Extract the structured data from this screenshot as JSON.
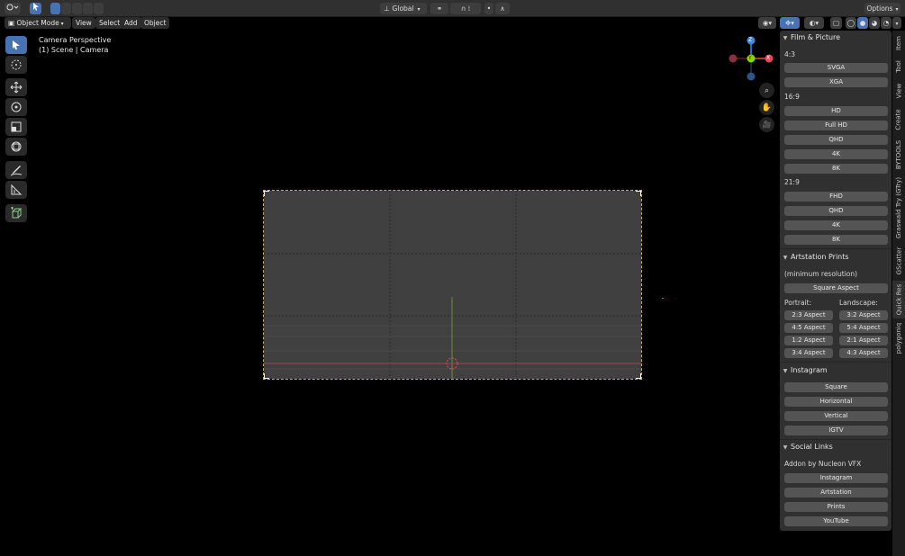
{
  "header": {
    "transform_orientation": "Global",
    "options_label": "Options"
  },
  "menubar": {
    "mode": "Object Mode",
    "items": [
      "View",
      "Select",
      "Add",
      "Object"
    ]
  },
  "viewport": {
    "perspective_label": "Camera Perspective",
    "scene_label": "(1) Scene | Camera",
    "gizmo": {
      "z": "Z",
      "y": "Y",
      "x": "X"
    }
  },
  "panel": {
    "film": {
      "title": "Film & Picture",
      "ratio_4_3": "4:3",
      "buttons_4_3": [
        "SVGA",
        "XGA"
      ],
      "ratio_16_9": "16:9",
      "buttons_16_9": [
        "HD",
        "Full HD",
        "QHD",
        "4K",
        "8K"
      ],
      "ratio_21_9": "21:9",
      "buttons_21_9": [
        "FHD",
        "QHD",
        "4K",
        "8K"
      ]
    },
    "artstation": {
      "title": "Artstation Prints",
      "note": "(minimum resolution)",
      "square": "Square Aspect",
      "portrait_label": "Portrait:",
      "landscape_label": "Landscape:",
      "portrait": [
        "2:3 Aspect",
        "4:5 Aspect",
        "1:2 Aspect",
        "3:4 Aspect"
      ],
      "landscape": [
        "3:2 Aspect",
        "5:4 Aspect",
        "2:1 Aspect",
        "4:3 Aspect"
      ]
    },
    "instagram": {
      "title": "Instagram",
      "buttons": [
        "Square",
        "Horizontal",
        "Vertical",
        "IGTV"
      ]
    },
    "social": {
      "title": "Social Links",
      "note": "Addon by Nucleon VFX",
      "buttons": [
        "Instagram",
        "Artstation",
        "Prints",
        "YouTube"
      ]
    }
  },
  "tabs": [
    "Item",
    "Tool",
    "View",
    "Create",
    "BYTOOLS",
    "Graswald Try (GTry)",
    "GScatter",
    "Quick Res",
    "polygoniq"
  ],
  "active_tab": "Quick Res",
  "colors": {
    "accent": "#4772b3",
    "x_axis": "#e84656",
    "y_axis": "#8bd600",
    "z_axis": "#3c8ae0",
    "panel_bg": "#303030",
    "button_bg": "#545454",
    "camera_bg": "#404040"
  }
}
